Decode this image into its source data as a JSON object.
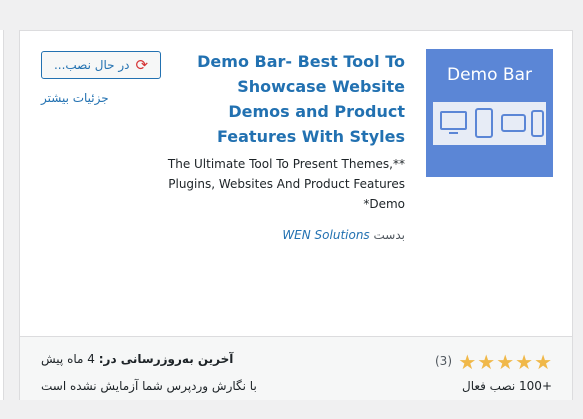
{
  "plugin": {
    "title_lines": [
      "Demo Bar- Best Tool To",
      "Showcase Website",
      "Demos and Product",
      "Features With Styles"
    ],
    "description_lines": [
      "The Ultimate Tool To Present Themes,**",
      "Plugins, Websites And Product Features",
      "*Demo"
    ],
    "author_prefix": "بدست",
    "author_name": "WEN Solutions",
    "thumbnail_text": "Demo Bar",
    "thumbnail_color": "#5b86d6"
  },
  "actions": {
    "install_label": "در حال نصب...",
    "install_icon": "refresh-icon",
    "more_details": "جزئیات بیشتر"
  },
  "footer": {
    "rating_stars": 5,
    "rating_count": "(3)",
    "active_installs": "+100 نصب فعال",
    "last_updated_label": "آخرین به‌روزرسانی در:",
    "last_updated_value": "4 ماه پیش",
    "compatibility": "با نگارش وردپرس شما آزمایش نشده است"
  },
  "colors": {
    "link": "#2271b1",
    "star": "#f0b849",
    "spinner": "#d63638"
  }
}
